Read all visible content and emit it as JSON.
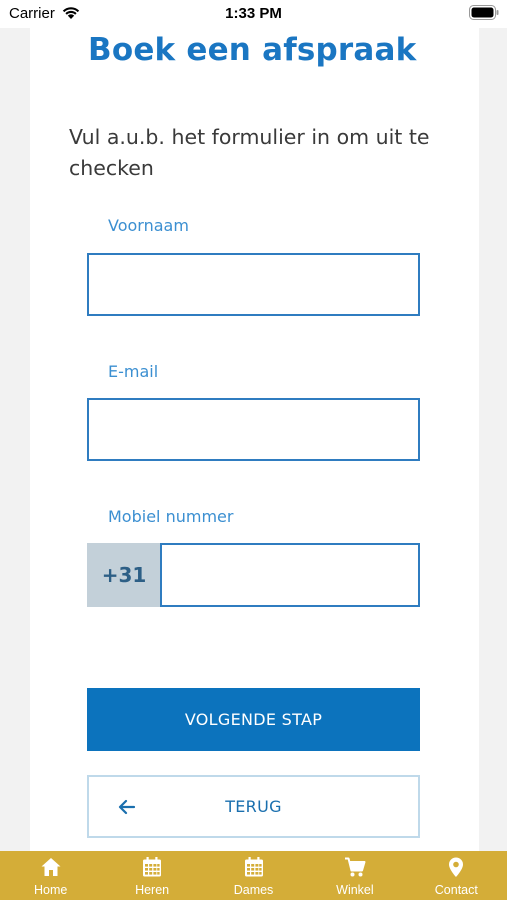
{
  "status_bar": {
    "carrier": "Carrier",
    "time": "1:33 PM"
  },
  "page": {
    "title": "Boek een afspraak",
    "intro": "Vul a.u.b. het formulier in om uit te checken"
  },
  "form": {
    "first_name": {
      "label": "Voornaam",
      "value": "",
      "placeholder": ""
    },
    "email": {
      "label": "E-mail",
      "value": "",
      "placeholder": ""
    },
    "mobile": {
      "label": "Mobiel nummer",
      "prefix": "+31",
      "value": "",
      "placeholder": ""
    }
  },
  "buttons": {
    "next_label": "VOLGENDE STAP",
    "back_label": "TERUG"
  },
  "tab_bar": {
    "tabs": [
      {
        "label": "Home",
        "icon": "home-icon"
      },
      {
        "label": "Heren",
        "icon": "calendar-icon"
      },
      {
        "label": "Dames",
        "icon": "calendar-icon"
      },
      {
        "label": "Winkel",
        "icon": "cart-icon"
      },
      {
        "label": "Contact",
        "icon": "location-pin-icon"
      }
    ]
  },
  "colors": {
    "accent": "#1a76c2",
    "primary_button": "#0c73bd",
    "tab_bar": "#d4ad38",
    "prefix_bg": "#c3d0d9"
  }
}
